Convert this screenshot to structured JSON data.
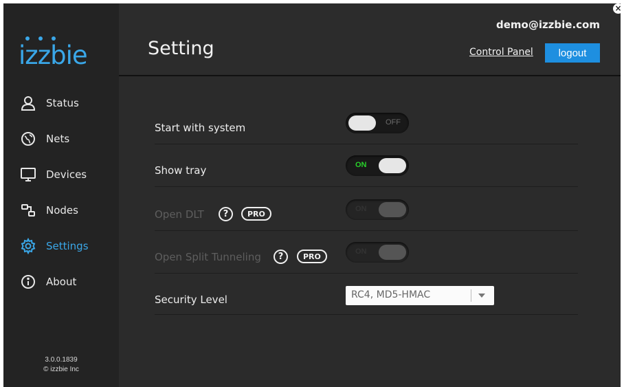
{
  "app": {
    "logo_text": "izzbie"
  },
  "header": {
    "title": "Setting",
    "user_email": "demo@izzbie.com",
    "control_panel_label": "Control Panel",
    "logout_label": "logout",
    "close_icon": "close-icon"
  },
  "sidebar": {
    "items": [
      {
        "label": "Status",
        "icon": "user-icon",
        "active": false
      },
      {
        "label": "Nets",
        "icon": "globe-icon",
        "active": false
      },
      {
        "label": "Devices",
        "icon": "monitor-icon",
        "active": false
      },
      {
        "label": "Nodes",
        "icon": "nodes-icon",
        "active": false
      },
      {
        "label": "Settings",
        "icon": "gear-icon",
        "active": true
      },
      {
        "label": "About",
        "icon": "info-icon",
        "active": false
      }
    ],
    "version": "3.0.0.1839",
    "copyright": "© izzbie Inc"
  },
  "settings": {
    "start_with_system": {
      "label": "Start with system",
      "state": "OFF"
    },
    "show_tray": {
      "label": "Show tray",
      "state": "ON"
    },
    "open_dlt": {
      "label": "Open DLT",
      "help": "?",
      "badge": "PRO",
      "state": "ON"
    },
    "open_split_tunneling": {
      "label": "Open Split Tunneling",
      "help": "?",
      "badge": "PRO",
      "state": "ON"
    },
    "security_level": {
      "label": "Security Level",
      "value": "RC4, MD5-HMAC"
    }
  },
  "colors": {
    "accent": "#3aa7e8",
    "logout_bg": "#1e8fe0",
    "on_text": "#28d22a",
    "background": "#2b2b2b"
  }
}
